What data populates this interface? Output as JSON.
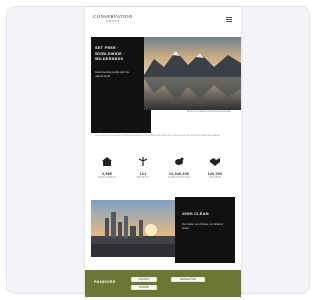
{
  "logo": {
    "name": "CONSERVATION",
    "tagline": "GROUP"
  },
  "hero": {
    "title": "SET FREE · WORLDWIDE · WILDERNESS",
    "text": "Reconnecting people with the natural world",
    "side_text": "Explore our latest field reports and projects"
  },
  "intro": "Our mission is to protect wild places and the communities that depend on them across the globe for future generations.",
  "stats": [
    {
      "icon": "home-icon",
      "value": "2,985",
      "label": "HOMES REBUILT"
    },
    {
      "icon": "tree-icon",
      "value": "121",
      "label": "PROJECTS"
    },
    {
      "icon": "bird-icon",
      "value": "12,346,400",
      "label": "ACRES PROTECTED"
    },
    {
      "icon": "handshake-icon",
      "value": "120,000",
      "label": "PARTNERS"
    }
  ],
  "section": {
    "title": "100% CLEAN",
    "text": "Our cities, our climate, our shared future."
  },
  "footer": {
    "title": "PANDORE",
    "links": [
      "CONTACT",
      "NEWSLETTER",
      "DONATE"
    ]
  },
  "colors": {
    "accent": "#6c7635",
    "dark": "#111111"
  }
}
